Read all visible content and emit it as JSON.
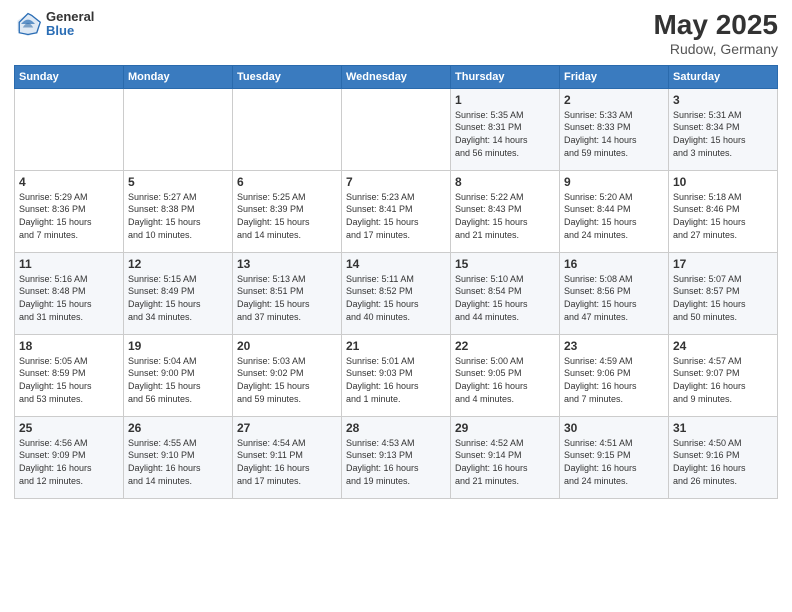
{
  "logo": {
    "general": "General",
    "blue": "Blue"
  },
  "title": "May 2025",
  "subtitle": "Rudow, Germany",
  "days_header": [
    "Sunday",
    "Monday",
    "Tuesday",
    "Wednesday",
    "Thursday",
    "Friday",
    "Saturday"
  ],
  "weeks": [
    [
      {
        "day": "",
        "info": ""
      },
      {
        "day": "",
        "info": ""
      },
      {
        "day": "",
        "info": ""
      },
      {
        "day": "",
        "info": ""
      },
      {
        "day": "1",
        "info": "Sunrise: 5:35 AM\nSunset: 8:31 PM\nDaylight: 14 hours\nand 56 minutes."
      },
      {
        "day": "2",
        "info": "Sunrise: 5:33 AM\nSunset: 8:33 PM\nDaylight: 14 hours\nand 59 minutes."
      },
      {
        "day": "3",
        "info": "Sunrise: 5:31 AM\nSunset: 8:34 PM\nDaylight: 15 hours\nand 3 minutes."
      }
    ],
    [
      {
        "day": "4",
        "info": "Sunrise: 5:29 AM\nSunset: 8:36 PM\nDaylight: 15 hours\nand 7 minutes."
      },
      {
        "day": "5",
        "info": "Sunrise: 5:27 AM\nSunset: 8:38 PM\nDaylight: 15 hours\nand 10 minutes."
      },
      {
        "day": "6",
        "info": "Sunrise: 5:25 AM\nSunset: 8:39 PM\nDaylight: 15 hours\nand 14 minutes."
      },
      {
        "day": "7",
        "info": "Sunrise: 5:23 AM\nSunset: 8:41 PM\nDaylight: 15 hours\nand 17 minutes."
      },
      {
        "day": "8",
        "info": "Sunrise: 5:22 AM\nSunset: 8:43 PM\nDaylight: 15 hours\nand 21 minutes."
      },
      {
        "day": "9",
        "info": "Sunrise: 5:20 AM\nSunset: 8:44 PM\nDaylight: 15 hours\nand 24 minutes."
      },
      {
        "day": "10",
        "info": "Sunrise: 5:18 AM\nSunset: 8:46 PM\nDaylight: 15 hours\nand 27 minutes."
      }
    ],
    [
      {
        "day": "11",
        "info": "Sunrise: 5:16 AM\nSunset: 8:48 PM\nDaylight: 15 hours\nand 31 minutes."
      },
      {
        "day": "12",
        "info": "Sunrise: 5:15 AM\nSunset: 8:49 PM\nDaylight: 15 hours\nand 34 minutes."
      },
      {
        "day": "13",
        "info": "Sunrise: 5:13 AM\nSunset: 8:51 PM\nDaylight: 15 hours\nand 37 minutes."
      },
      {
        "day": "14",
        "info": "Sunrise: 5:11 AM\nSunset: 8:52 PM\nDaylight: 15 hours\nand 40 minutes."
      },
      {
        "day": "15",
        "info": "Sunrise: 5:10 AM\nSunset: 8:54 PM\nDaylight: 15 hours\nand 44 minutes."
      },
      {
        "day": "16",
        "info": "Sunrise: 5:08 AM\nSunset: 8:56 PM\nDaylight: 15 hours\nand 47 minutes."
      },
      {
        "day": "17",
        "info": "Sunrise: 5:07 AM\nSunset: 8:57 PM\nDaylight: 15 hours\nand 50 minutes."
      }
    ],
    [
      {
        "day": "18",
        "info": "Sunrise: 5:05 AM\nSunset: 8:59 PM\nDaylight: 15 hours\nand 53 minutes."
      },
      {
        "day": "19",
        "info": "Sunrise: 5:04 AM\nSunset: 9:00 PM\nDaylight: 15 hours\nand 56 minutes."
      },
      {
        "day": "20",
        "info": "Sunrise: 5:03 AM\nSunset: 9:02 PM\nDaylight: 15 hours\nand 59 minutes."
      },
      {
        "day": "21",
        "info": "Sunrise: 5:01 AM\nSunset: 9:03 PM\nDaylight: 16 hours\nand 1 minute."
      },
      {
        "day": "22",
        "info": "Sunrise: 5:00 AM\nSunset: 9:05 PM\nDaylight: 16 hours\nand 4 minutes."
      },
      {
        "day": "23",
        "info": "Sunrise: 4:59 AM\nSunset: 9:06 PM\nDaylight: 16 hours\nand 7 minutes."
      },
      {
        "day": "24",
        "info": "Sunrise: 4:57 AM\nSunset: 9:07 PM\nDaylight: 16 hours\nand 9 minutes."
      }
    ],
    [
      {
        "day": "25",
        "info": "Sunrise: 4:56 AM\nSunset: 9:09 PM\nDaylight: 16 hours\nand 12 minutes."
      },
      {
        "day": "26",
        "info": "Sunrise: 4:55 AM\nSunset: 9:10 PM\nDaylight: 16 hours\nand 14 minutes."
      },
      {
        "day": "27",
        "info": "Sunrise: 4:54 AM\nSunset: 9:11 PM\nDaylight: 16 hours\nand 17 minutes."
      },
      {
        "day": "28",
        "info": "Sunrise: 4:53 AM\nSunset: 9:13 PM\nDaylight: 16 hours\nand 19 minutes."
      },
      {
        "day": "29",
        "info": "Sunrise: 4:52 AM\nSunset: 9:14 PM\nDaylight: 16 hours\nand 21 minutes."
      },
      {
        "day": "30",
        "info": "Sunrise: 4:51 AM\nSunset: 9:15 PM\nDaylight: 16 hours\nand 24 minutes."
      },
      {
        "day": "31",
        "info": "Sunrise: 4:50 AM\nSunset: 9:16 PM\nDaylight: 16 hours\nand 26 minutes."
      }
    ]
  ]
}
